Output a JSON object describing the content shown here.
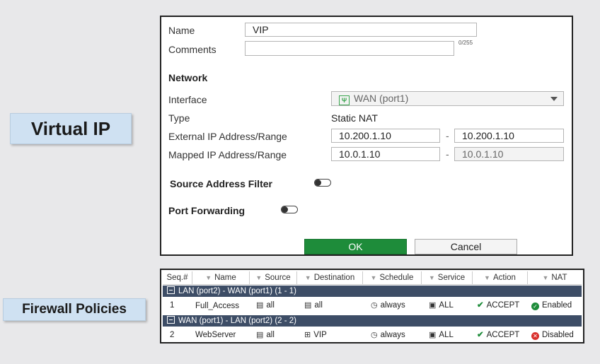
{
  "labels": {
    "virtual_ip": "Virtual IP",
    "firewall_policies": "Firewall Policies"
  },
  "form": {
    "name_label": "Name",
    "name_value": "VIP",
    "comments_label": "Comments",
    "comments_counter": "0/255",
    "network_heading": "Network",
    "interface_label": "Interface",
    "interface_value": "WAN (port1)",
    "type_label": "Type",
    "type_value": "Static NAT",
    "external_label": "External IP Address/Range",
    "external_start": "10.200.1.10",
    "external_end": "10.200.1.10",
    "mapped_label": "Mapped IP Address/Range",
    "mapped_start": "10.0.1.10",
    "mapped_end": "10.0.1.10",
    "range_separator": "-",
    "source_filter_label": "Source Address Filter",
    "port_forwarding_label": "Port Forwarding",
    "ok_label": "OK",
    "cancel_label": "Cancel"
  },
  "table": {
    "headers": [
      "Seq.#",
      "Name",
      "Source",
      "Destination",
      "Schedule",
      "Service",
      "Action",
      "NAT"
    ],
    "groups": [
      {
        "title": "LAN (port2) - WAN (port1) (1 - 1)",
        "rows": [
          {
            "seq": "1",
            "name": "Full_Access",
            "source": "all",
            "destination": "all",
            "schedule": "always",
            "service": "ALL",
            "action": "ACCEPT",
            "nat": "Enabled"
          }
        ]
      },
      {
        "title": "WAN (port1) - LAN (port2) (2 - 2)",
        "rows": [
          {
            "seq": "2",
            "name": "WebServer",
            "source": "all",
            "destination": "VIP",
            "schedule": "always",
            "service": "ALL",
            "action": "ACCEPT",
            "nat": "Disabled"
          }
        ]
      }
    ]
  },
  "colors": {
    "ok_button": "#1e8c3a",
    "group_bar": "#3d4d66",
    "label_bg": "#cfe1f2"
  }
}
